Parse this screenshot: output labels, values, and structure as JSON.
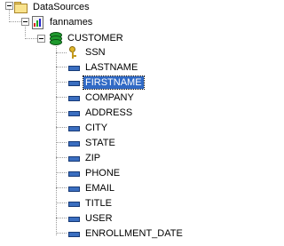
{
  "tree": {
    "root": {
      "label": "DataSources",
      "icon": "folder-icon",
      "expanded": true
    },
    "datasource": {
      "label": "fannames",
      "icon": "datasource-icon",
      "expanded": true
    },
    "table": {
      "label": "CUSTOMER",
      "icon": "table-icon",
      "expanded": true
    },
    "fields": [
      {
        "label": "SSN",
        "icon": "key-icon",
        "selected": false
      },
      {
        "label": "LASTNAME",
        "icon": "field-icon",
        "selected": false
      },
      {
        "label": "FIRSTNAME",
        "icon": "field-icon",
        "selected": true
      },
      {
        "label": "COMPANY",
        "icon": "field-icon",
        "selected": false
      },
      {
        "label": "ADDRESS",
        "icon": "field-icon",
        "selected": false
      },
      {
        "label": "CITY",
        "icon": "field-icon",
        "selected": false
      },
      {
        "label": "STATE",
        "icon": "field-icon",
        "selected": false
      },
      {
        "label": "ZIP",
        "icon": "field-icon",
        "selected": false
      },
      {
        "label": "PHONE",
        "icon": "field-icon",
        "selected": false
      },
      {
        "label": "EMAIL",
        "icon": "field-icon",
        "selected": false
      },
      {
        "label": "TITLE",
        "icon": "field-icon",
        "selected": false
      },
      {
        "label": "USER",
        "icon": "field-icon",
        "selected": false
      },
      {
        "label": "ENROLLMENT_DATE",
        "icon": "field-icon",
        "selected": false
      }
    ],
    "colors": {
      "selection": "#316ac5",
      "folder": "#f9e38d",
      "table": "#1f9a2e",
      "field": "#3a6ec0",
      "key": "#e1b72c"
    }
  }
}
